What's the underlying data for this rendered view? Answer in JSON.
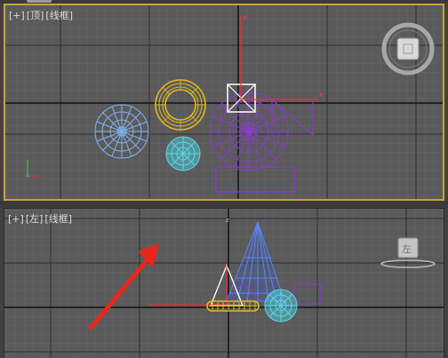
{
  "viewports": {
    "top": {
      "label": {
        "plus": "[+]",
        "view": "[顶]",
        "shading": "[线框]"
      },
      "axis_x": "x",
      "axis_y": "y"
    },
    "left": {
      "label": {
        "plus": "[+]",
        "view": "[左]",
        "shading": "[线框]"
      },
      "axis_z": "z",
      "cube_face": "左"
    }
  },
  "colors": {
    "viewport_bg": "#5a5a5a",
    "active_border": "#c9a23a",
    "grid_minor": "#666666",
    "grid_major": "#2b2b2b",
    "selection": "#ffffff",
    "transform_axis": "#ff2a2a",
    "geosphere": "#7fb2ef",
    "torus": "#e2b71d",
    "sphere": "#5fd7e4",
    "purple_objects": "#8a3ad0",
    "cone": "#5a86f0",
    "annotation_arrow": "#e8261c"
  },
  "icons": {
    "view_cube_top": "view-cube-icon",
    "view_cube_left": "view-cube-icon",
    "axis_tripod": "axis-tripod-icon",
    "annotation": "red-arrow-annotation"
  }
}
